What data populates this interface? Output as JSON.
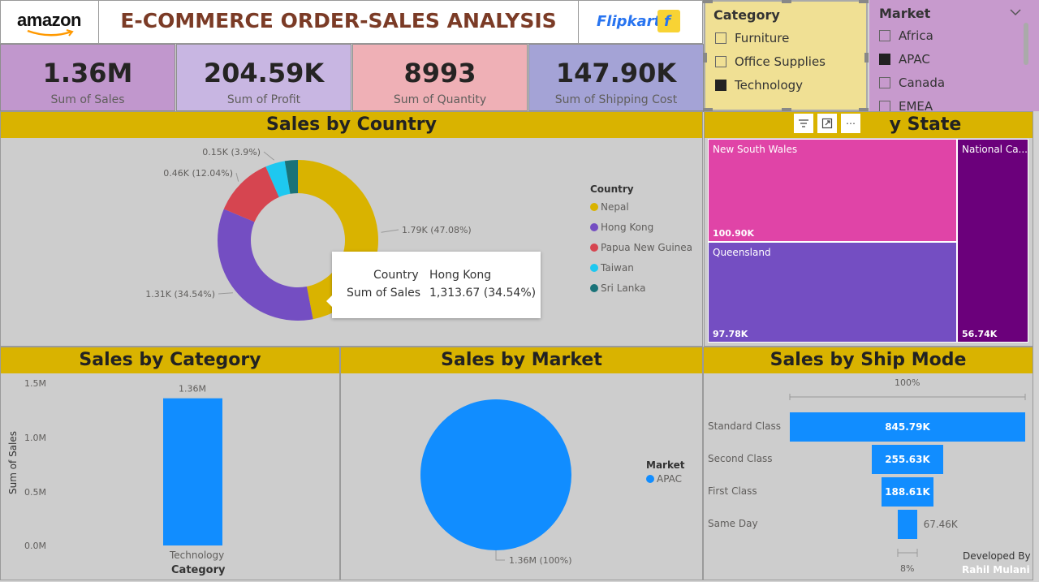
{
  "header": {
    "amazon_logo": "amazon",
    "title": "E-COMMERCE ORDER-SALES ANALYSIS",
    "flipkart_logo": "Flipkart"
  },
  "kpis": [
    {
      "value": "1.36M",
      "label": "Sum of Sales",
      "color": "#c197cd"
    },
    {
      "value": "204.59K",
      "label": "Sum of Profit",
      "color": "#c8b6e2"
    },
    {
      "value": "8993",
      "label": "Sum of Quantity",
      "color": "#efb0b6"
    },
    {
      "value": "147.90K",
      "label": "Sum of Shipping Cost",
      "color": "#a4a3d6"
    }
  ],
  "category_slicer": {
    "title": "Category",
    "items": [
      {
        "label": "Furniture",
        "checked": false
      },
      {
        "label": "Office Supplies",
        "checked": false
      },
      {
        "label": "Technology",
        "checked": true
      }
    ]
  },
  "market_slicer": {
    "title": "Market",
    "items": [
      {
        "label": "Africa",
        "checked": false
      },
      {
        "label": "APAC",
        "checked": true
      },
      {
        "label": "Canada",
        "checked": false
      },
      {
        "label": "EMEA",
        "checked": false
      }
    ]
  },
  "country_chart": {
    "title": "Sales by Country",
    "legend_title": "Country",
    "tooltip": {
      "k1": "Country",
      "v1": "Hong Kong",
      "k2": "Sum of Sales",
      "v2": "1,313.67 (34.54%)"
    }
  },
  "state_chart": {
    "title_visible": "y State",
    "cells": [
      {
        "name": "New South Wales",
        "value": "100.90K"
      },
      {
        "name": "Queensland",
        "value": "97.78K"
      },
      {
        "name": "National Ca...",
        "value": "56.74K"
      }
    ]
  },
  "category_chart": {
    "title": "Sales by Category",
    "ylabel": "Sum of Sales",
    "xlabel": "Category",
    "ticks": [
      "1.5M",
      "1.0M",
      "0.5M",
      "0.0M"
    ]
  },
  "market_chart": {
    "title": "Sales by Market",
    "legend_title": "Market"
  },
  "shipmode_chart": {
    "title": "Sales by Ship Mode",
    "top_pct": "100%",
    "bottom_pct": "8%"
  },
  "footer": {
    "developed_by": "Developed By",
    "author": "Rahil Mulani"
  },
  "chart_data": [
    {
      "type": "pie",
      "variant": "donut",
      "title": "Sales by Country",
      "legend_title": "Country",
      "legend_position": "right",
      "slices": [
        {
          "name": "Nepal",
          "value": 1.79,
          "label": "1.79K (47.08%)",
          "color": "#d9b300"
        },
        {
          "name": "Hong Kong",
          "value": 1.31,
          "label": "1.31K (34.54%)",
          "color": "#744ec2"
        },
        {
          "name": "Papua New Guinea",
          "value": 0.46,
          "label": "0.46K (12.04%)",
          "color": "#d64550"
        },
        {
          "name": "Taiwan",
          "value": 0.15,
          "label": "0.15K (3.9%)",
          "color": "#1ec8f0"
        },
        {
          "name": "Sri Lanka",
          "value": 0.1,
          "label": "",
          "color": "#197278"
        }
      ]
    },
    {
      "type": "bar",
      "title": "Sales by Category",
      "categories": [
        "Technology"
      ],
      "values": [
        1.36
      ],
      "labels": [
        "1.36M"
      ],
      "xlabel": "Category",
      "ylabel": "Sum of Sales",
      "ylim": [
        0,
        1.5
      ],
      "color": "#118dff"
    },
    {
      "type": "pie",
      "title": "Sales by Market",
      "legend_title": "Market",
      "legend_position": "right",
      "slices": [
        {
          "name": "APAC",
          "value": 1.36,
          "label": "1.36M (100%)",
          "color": "#118dff"
        }
      ]
    },
    {
      "type": "bar",
      "variant": "funnel",
      "title": "Sales by Ship Mode",
      "categories": [
        "Standard Class",
        "Second Class",
        "First Class",
        "Same Day"
      ],
      "values": [
        845.79,
        255.63,
        188.61,
        67.46
      ],
      "labels": [
        "845.79K",
        "255.63K",
        "188.61K",
        "67.46K"
      ],
      "color": "#118dff"
    }
  ]
}
